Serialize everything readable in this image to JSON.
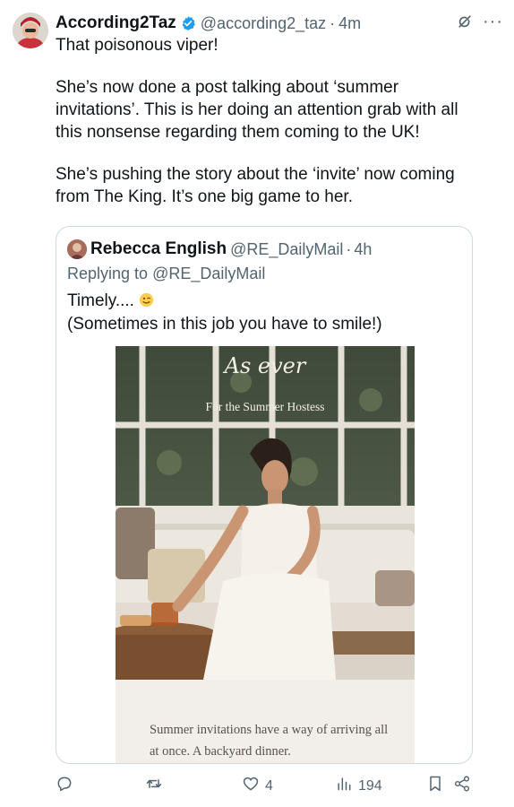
{
  "tweet": {
    "author_name": "According2Taz",
    "handle": "@according2_taz",
    "separator": "·",
    "time": "4m",
    "paragraphs": [
      "That poisonous viper!",
      "She’s now done a post talking about ‘summer invitations’. This is her doing an attention grab with all this nonsense regarding them coming to the UK!",
      "She’s pushing the story about the ‘invite’ now coming from The King. It’s one big game to her."
    ]
  },
  "quote": {
    "author_name": "Rebecca English",
    "handle": "@RE_DailyMail",
    "separator": "·",
    "time": "4h",
    "replying_prefix": "Replying to ",
    "replying_to": "@RE_DailyMail",
    "line1": "Timely....",
    "line2": "(Sometimes in this job you have to smile!)",
    "media": {
      "script_text": "As ever",
      "caption": "For the Summer Hostess",
      "card_text": "Summer invitations have a way of arriving all at once. A backyard dinner."
    }
  },
  "actions": {
    "likes": "4",
    "views": "194"
  },
  "icons": [
    "verified-badge-icon",
    "grok-icon",
    "more-icon",
    "reply-icon",
    "retweet-icon",
    "like-icon",
    "views-icon",
    "bookmark-icon",
    "share-icon"
  ],
  "colors": {
    "verified_blue": "#1d9bf0",
    "secondary_text": "#536471",
    "border": "#cfd9de"
  }
}
